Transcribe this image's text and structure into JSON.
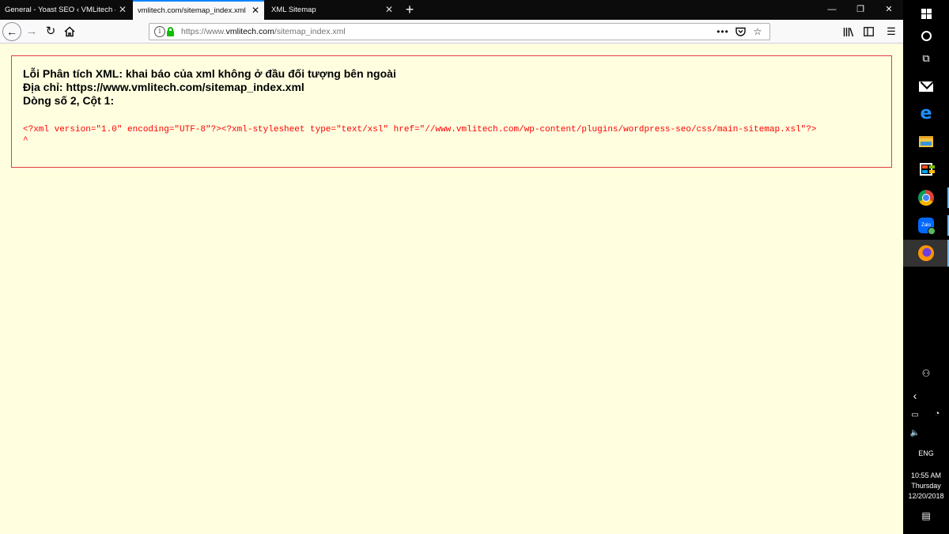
{
  "tabs": [
    {
      "label": "General - Yoast SEO ‹ VMLitech — WordPress",
      "active": false
    },
    {
      "label": "vmlitech.com/sitemap_index.xml",
      "active": true
    },
    {
      "label": "XML Sitemap",
      "active": false
    }
  ],
  "tab_close_glyph": "✕",
  "new_tab_glyph": "+",
  "window_controls": {
    "minimize": "—",
    "maximize": "❐",
    "close": "✕"
  },
  "url": {
    "prefix": "https://www.",
    "host": "vmlitech.com",
    "path": "/sitemap_index.xml"
  },
  "page_actions_glyph": "•••",
  "error": {
    "heading_line1": "Lỗi Phân tích XML: khai báo của xml không ở đầu đối tượng bên ngoài",
    "heading_line2": "Địa chỉ: https://www.vmlitech.com/sitemap_index.xml",
    "heading_line3": "Dòng số 2, Cột 1:",
    "source": "<?xml version=\"1.0\" encoding=\"UTF-8\"?><?xml-stylesheet type=\"text/xsl\" href=\"//www.vmlitech.com/wp-content/plugins/wordpress-seo/css/main-sitemap.xsl\"?>",
    "caret": "^"
  },
  "colors": {
    "page_background": "#ffffe0",
    "error_border": "#e04040",
    "error_source_text": "#ff0000",
    "active_tab_accent": "#0a84ff",
    "lock_green": "#12bc00",
    "taskbar": "#000000"
  },
  "icons": {
    "back": "arrow-left-icon",
    "forward": "arrow-right-icon",
    "reload": "reload-icon",
    "home": "home-icon",
    "info": "info-icon",
    "lock": "lock-icon",
    "pocket": "pocket-icon",
    "bookmark": "star-icon",
    "library": "library-icon",
    "sidebar": "sidebar-icon",
    "menu": "hamburger-menu-icon"
  },
  "taskbar": {
    "apps": [
      "mail",
      "edge",
      "file-explorer",
      "store",
      "chrome",
      "zalo",
      "firefox"
    ],
    "active_app": "firefox",
    "zalo_label": "Zalo",
    "language": "ENG",
    "time": "10:55 AM",
    "day": "Thursday",
    "date": "12/20/2018"
  }
}
